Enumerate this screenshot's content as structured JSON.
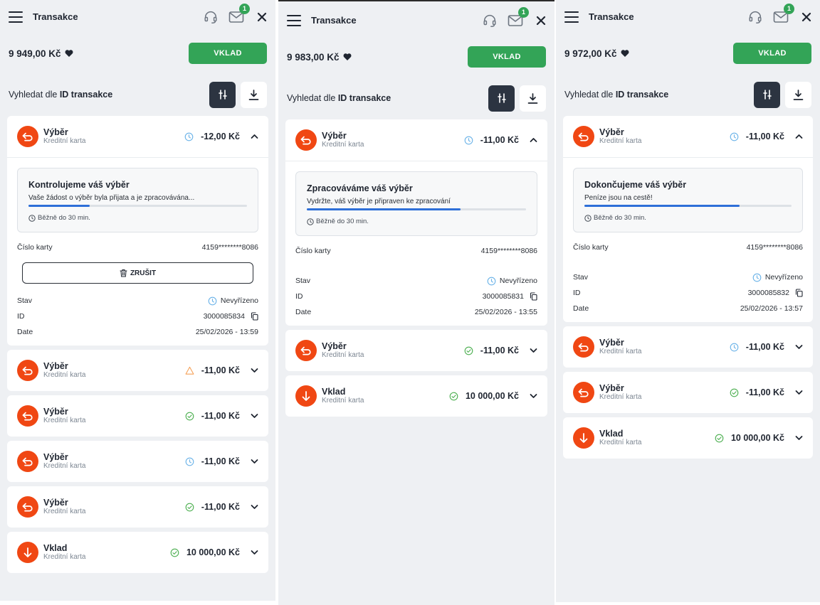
{
  "colors": {
    "accent_green": "#33a457",
    "tx_icon_orange": "#f04713",
    "progress_blue": "#2e6fd8",
    "pending_blue": "#6bb3e8",
    "success_green": "#4caf50",
    "warning_orange": "#f5a25a"
  },
  "panels": [
    {
      "header": {
        "title": "Transakce",
        "badge": "1"
      },
      "balance": "9 949,00 Kč",
      "deposit_label": "VKLAD",
      "search": {
        "prefix": "Vyhledat dle",
        "bold": "ID transakce"
      },
      "expanded": {
        "name": "Výběr",
        "sub": "Kreditní karta",
        "amount": "-12,00 Kč",
        "status_icon": "clock-icon",
        "progress": {
          "title": "Kontrolujeme váš výběr",
          "desc": "Vaše žádost o výběr byla přijata a je zpracovávána...",
          "fraction": 0.28,
          "time": "Běžně do 30 min."
        },
        "card_label": "Číslo karty",
        "card_value": "4159********8086",
        "cancel_label": "ZRUŠIT",
        "status_label": "Stav",
        "status_value": "Nevyřízeno",
        "id_label": "ID",
        "id_value": "3000085834",
        "date_label": "Date",
        "date_value": "25/02/2026 - 13:59"
      },
      "rows": [
        {
          "name": "Výběr",
          "sub": "Kreditní karta",
          "amount": "-11,00 Kč",
          "status_icon": "warning-icon",
          "icon": "withdraw-icon"
        },
        {
          "name": "Výběr",
          "sub": "Kreditní karta",
          "amount": "-11,00 Kč",
          "status_icon": "check-icon",
          "icon": "withdraw-icon"
        },
        {
          "name": "Výběr",
          "sub": "Kreditní karta",
          "amount": "-11,00 Kč",
          "status_icon": "clock-icon",
          "icon": "withdraw-icon"
        },
        {
          "name": "Výběr",
          "sub": "Kreditní karta",
          "amount": "-11,00 Kč",
          "status_icon": "check-icon",
          "icon": "withdraw-icon"
        },
        {
          "name": "Vklad",
          "sub": "Kreditní karta",
          "amount": "10 000,00 Kč",
          "status_icon": "check-icon",
          "icon": "deposit-icon"
        }
      ]
    },
    {
      "header": {
        "title": "Transakce",
        "badge": "1"
      },
      "balance": "9 983,00 Kč",
      "deposit_label": "VKLAD",
      "search": {
        "prefix": "Vyhledat dle",
        "bold": "ID transakce"
      },
      "expanded": {
        "name": "Výběr",
        "sub": "Kreditní karta",
        "amount": "-11,00 Kč",
        "status_icon": "clock-icon",
        "progress": {
          "title": "Zpracováváme váš výběr",
          "desc": "Vydržte, váš výběr je připraven ke zpracování",
          "fraction": 0.7,
          "time": "Běžně do 30 min."
        },
        "card_label": "Číslo karty",
        "card_value": "4159********8086",
        "status_label": "Stav",
        "status_value": "Nevyřízeno",
        "id_label": "ID",
        "id_value": "3000085831",
        "date_label": "Date",
        "date_value": "25/02/2026 - 13:55"
      },
      "rows": [
        {
          "name": "Výběr",
          "sub": "Kreditní karta",
          "amount": "-11,00 Kč",
          "status_icon": "check-icon",
          "icon": "withdraw-icon"
        },
        {
          "name": "Vklad",
          "sub": "Kreditní karta",
          "amount": "10 000,00 Kč",
          "status_icon": "check-icon",
          "icon": "deposit-icon"
        }
      ]
    },
    {
      "header": {
        "title": "Transakce",
        "badge": "1"
      },
      "balance": "9 972,00 Kč",
      "deposit_label": "VKLAD",
      "search": {
        "prefix": "Vyhledat dle",
        "bold": "ID transakce"
      },
      "expanded": {
        "name": "Výběr",
        "sub": "Kreditní karta",
        "amount": "-11,00 Kč",
        "status_icon": "clock-icon",
        "progress": {
          "title": "Dokončujeme váš výběr",
          "desc": "Peníze jsou na cestě!",
          "fraction": 0.75,
          "time": "Běžně do 30 min."
        },
        "card_label": "Číslo karty",
        "card_value": "4159********8086",
        "status_label": "Stav",
        "status_value": "Nevyřízeno",
        "id_label": "ID",
        "id_value": "3000085832",
        "date_label": "Date",
        "date_value": "25/02/2026 - 13:57"
      },
      "rows": [
        {
          "name": "Výběr",
          "sub": "Kreditní karta",
          "amount": "-11,00 Kč",
          "status_icon": "clock-icon",
          "icon": "withdraw-icon"
        },
        {
          "name": "Výběr",
          "sub": "Kreditní karta",
          "amount": "-11,00 Kč",
          "status_icon": "check-icon",
          "icon": "withdraw-icon"
        },
        {
          "name": "Vklad",
          "sub": "Kreditní karta",
          "amount": "10 000,00 Kč",
          "status_icon": "check-icon",
          "icon": "deposit-icon"
        }
      ]
    }
  ]
}
